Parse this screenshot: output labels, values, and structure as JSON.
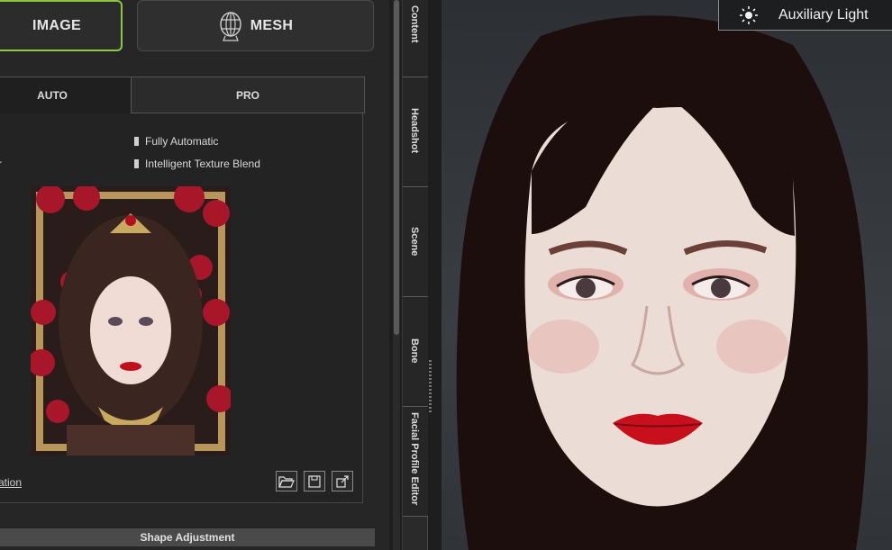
{
  "mode_buttons": {
    "image_label": "IMAGE",
    "mesh_label": "MESH"
  },
  "tabs": {
    "auto_label": "AUTO",
    "pro_label": "PRO"
  },
  "options": {
    "fully_automatic": "Fully Automatic",
    "intelligent_texture_blend": "Intelligent Texture Blend",
    "left_partial_label": "r"
  },
  "link_partial": "ation",
  "shape_adjustment_label": "Shape Adjustment",
  "side_tabs": [
    "Content",
    "Headshot",
    "Scene",
    "Bone",
    "Facial Profile Editor"
  ],
  "auxiliary_light_label": "Auxiliary Light",
  "colors": {
    "accent_green": "#8dc63f",
    "panel_bg": "#262626",
    "viewport_bg": "#353a3e"
  },
  "icons": [
    "mesh-globe-icon",
    "folder-open-icon",
    "save-icon",
    "external-link-icon",
    "sun-icon"
  ]
}
